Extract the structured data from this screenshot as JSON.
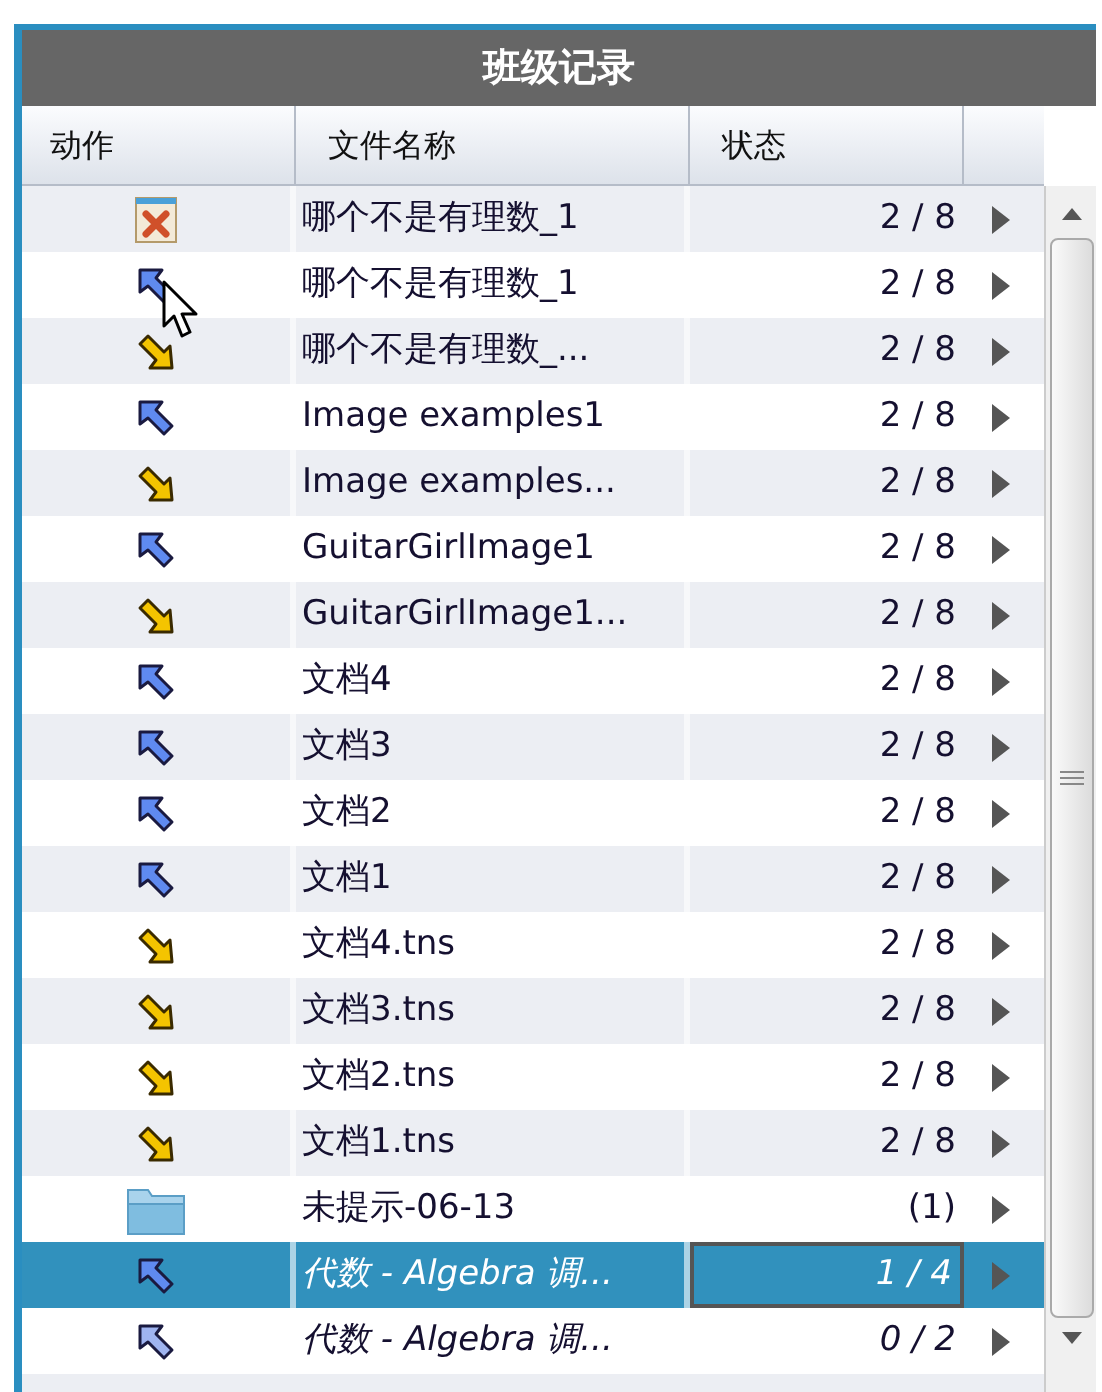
{
  "window": {
    "title": "班级记录"
  },
  "table": {
    "columns": [
      "动作",
      "文件名称",
      "状态"
    ],
    "rows": [
      {
        "kind": "error",
        "name": "哪个不是有理数_1",
        "status": "2 / 8",
        "selected": false,
        "italic": false
      },
      {
        "kind": "send",
        "name": "哪个不是有理数_1",
        "status": "2 / 8",
        "selected": false,
        "italic": false
      },
      {
        "kind": "collect",
        "name": "哪个不是有理数_...",
        "status": "2 / 8",
        "selected": false,
        "italic": false
      },
      {
        "kind": "send",
        "name": "Image examples1",
        "status": "2 / 8",
        "selected": false,
        "italic": false
      },
      {
        "kind": "collect",
        "name": "Image examples...",
        "status": "2 / 8",
        "selected": false,
        "italic": false
      },
      {
        "kind": "send",
        "name": "GuitarGirlImage1",
        "status": "2 / 8",
        "selected": false,
        "italic": false
      },
      {
        "kind": "collect",
        "name": "GuitarGirlImage1...",
        "status": "2 / 8",
        "selected": false,
        "italic": false
      },
      {
        "kind": "send",
        "name": "文档4",
        "status": "2 / 8",
        "selected": false,
        "italic": false
      },
      {
        "kind": "send",
        "name": "文档3",
        "status": "2 / 8",
        "selected": false,
        "italic": false
      },
      {
        "kind": "send",
        "name": "文档2",
        "status": "2 / 8",
        "selected": false,
        "italic": false
      },
      {
        "kind": "send",
        "name": "文档1",
        "status": "2 / 8",
        "selected": false,
        "italic": false
      },
      {
        "kind": "collect",
        "name": "文档4.tns",
        "status": "2 / 8",
        "selected": false,
        "italic": false
      },
      {
        "kind": "collect",
        "name": "文档3.tns",
        "status": "2 / 8",
        "selected": false,
        "italic": false
      },
      {
        "kind": "collect",
        "name": "文档2.tns",
        "status": "2 / 8",
        "selected": false,
        "italic": false
      },
      {
        "kind": "collect",
        "name": "文档1.tns",
        "status": "2 / 8",
        "selected": false,
        "italic": false
      },
      {
        "kind": "folder",
        "name": "未提示-06-13",
        "status": "(1)",
        "selected": false,
        "italic": false
      },
      {
        "kind": "send",
        "name": "代数 - Algebra 调...",
        "status": "1 / 4",
        "selected": true,
        "italic": true
      },
      {
        "kind": "send",
        "name": "代数 - Algebra 调...",
        "status": "0 / 2",
        "selected": false,
        "italic": true
      }
    ]
  }
}
